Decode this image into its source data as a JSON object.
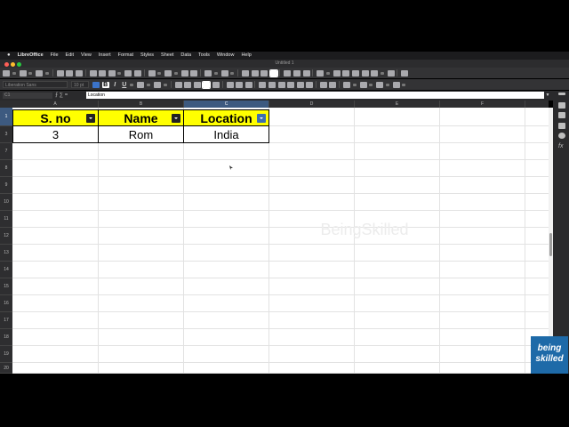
{
  "menubar": {
    "app_name": "LibreOffice",
    "items": [
      "File",
      "Edit",
      "View",
      "Insert",
      "Format",
      "Styles",
      "Sheet",
      "Data",
      "Tools",
      "Window",
      "Help"
    ]
  },
  "titlebar": {
    "title": "Untitled 1"
  },
  "toolbar2": {
    "font_name": "Liberation Sans",
    "font_size": "10 pt",
    "bold": "B",
    "italic": "I",
    "underline": "U"
  },
  "formulabar": {
    "name_box": "C1",
    "icons": "⨍  ∑  =",
    "formula": "Location"
  },
  "columns": [
    "A",
    "B",
    "C",
    "D",
    "E",
    "F"
  ],
  "rows": [
    "1",
    "3",
    "7",
    "8",
    "9",
    "10",
    "11",
    "12",
    "13",
    "14",
    "15",
    "16",
    "17",
    "18",
    "19",
    "20"
  ],
  "table": {
    "headers": [
      "S. no",
      "Name",
      "Location"
    ],
    "row": [
      "3",
      "Rom",
      "India"
    ]
  },
  "watermark": "BeingSkilled",
  "logo": {
    "line1": "being",
    "line2": "skilled"
  },
  "colors": {
    "header_fill": "#ffff00",
    "selected_header": "#3d5a80",
    "logo_bg": "#1e6aa8"
  }
}
